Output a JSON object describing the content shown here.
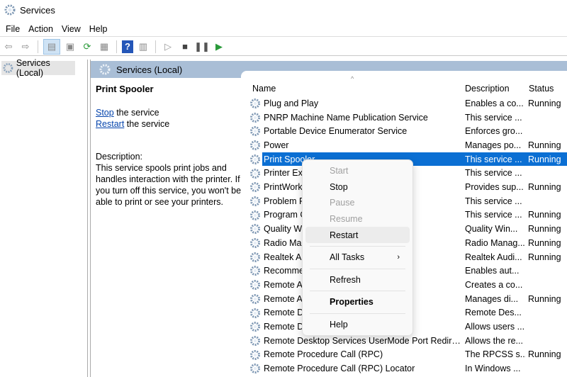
{
  "window": {
    "title": "Services"
  },
  "menu": [
    "File",
    "Action",
    "View",
    "Help"
  ],
  "toolbar": {
    "icons": [
      "back-icon",
      "forward-icon",
      "console-tree-icon",
      "properties-icon",
      "refresh-icon",
      "export-icon",
      "help-icon",
      "action-pane-icon",
      "start-icon",
      "stop-icon",
      "pause-icon",
      "resume-icon"
    ]
  },
  "tree": {
    "item": "Services (Local)"
  },
  "panel": {
    "title": "Services (Local)"
  },
  "details": {
    "service_name": "Print Spooler",
    "stop_link": "Stop",
    "stop_suffix": " the service",
    "restart_link": "Restart",
    "restart_suffix": " the service",
    "description_label": "Description:",
    "description": "This service spools print jobs and handles interaction with the printer. If you turn off this service, you won't be able to print or see your printers."
  },
  "columns": {
    "name": "Name",
    "description": "Description",
    "status": "Status"
  },
  "services": [
    {
      "name": "Plug and Play",
      "description": "Enables a co...",
      "status": "Running"
    },
    {
      "name": "PNRP Machine Name Publication Service",
      "description": "This service ...",
      "status": ""
    },
    {
      "name": "Portable Device Enumerator Service",
      "description": "Enforces gro...",
      "status": ""
    },
    {
      "name": "Power",
      "description": "Manages po...",
      "status": "Running"
    },
    {
      "name": "Print Spooler",
      "description": "This service ...",
      "status": "Running"
    },
    {
      "name": "Printer Ext",
      "description": "This service ...",
      "status": ""
    },
    {
      "name": "PrintWork",
      "description": "Provides sup...",
      "status": "Running"
    },
    {
      "name": "Problem R",
      "description": "This service ...",
      "status": ""
    },
    {
      "name": "Program C",
      "description": "This service ...",
      "status": "Running"
    },
    {
      "name": "Quality W",
      "description": "Quality Win...",
      "status": "Running"
    },
    {
      "name": "Radio Ma",
      "description": "Radio Manag...",
      "status": "Running"
    },
    {
      "name": "Realtek Au",
      "description": "Realtek Audi...",
      "status": "Running"
    },
    {
      "name": "Recomme",
      "description": "Enables aut...",
      "status": ""
    },
    {
      "name": "Remote A",
      "description": "Creates a co...",
      "status": ""
    },
    {
      "name": "Remote A",
      "description": "Manages di...",
      "status": "Running"
    },
    {
      "name": "Remote D",
      "description": "Remote Des...",
      "status": ""
    },
    {
      "name": "Remote D",
      "description": "Allows users ...",
      "status": ""
    },
    {
      "name": "Remote Desktop Services UserMode Port Redirect...",
      "description": "Allows the re...",
      "status": ""
    },
    {
      "name": "Remote Procedure Call (RPC)",
      "description": "The RPCSS s...",
      "status": "Running"
    },
    {
      "name": "Remote Procedure Call (RPC) Locator",
      "description": "In Windows ...",
      "status": ""
    }
  ],
  "selected_index": 4,
  "context_menu": {
    "items": [
      {
        "label": "Start",
        "disabled": true
      },
      {
        "label": "Stop"
      },
      {
        "label": "Pause",
        "disabled": true
      },
      {
        "label": "Resume",
        "disabled": true
      },
      {
        "label": "Restart",
        "hover": true
      },
      {
        "sep": true
      },
      {
        "label": "All Tasks",
        "submenu": true,
        "arrow": "›"
      },
      {
        "sep": true
      },
      {
        "label": "Refresh"
      },
      {
        "sep": true
      },
      {
        "label": "Properties",
        "bold": true
      },
      {
        "sep": true
      },
      {
        "label": "Help"
      }
    ]
  },
  "colors": {
    "selection": "#0b6fd3",
    "header_band": "#a9bed6"
  }
}
